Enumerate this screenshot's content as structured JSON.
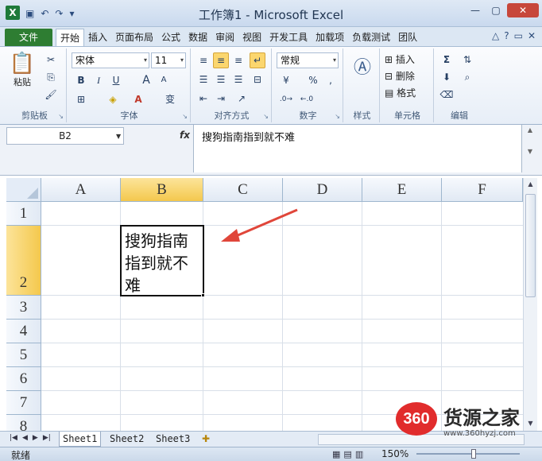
{
  "window": {
    "title": "工作簿1 - Microsoft Excel",
    "app_icon": "X",
    "quick_access": [
      "save-icon",
      "undo-icon",
      "redo-icon",
      "customize-icon"
    ],
    "controls": [
      "minimize-icon",
      "maximize-icon",
      "close-icon"
    ]
  },
  "ribbon_tabs": {
    "file": "文件",
    "items": [
      "开始",
      "插入",
      "页面布局",
      "公式",
      "数据",
      "审阅",
      "视图",
      "开发工具",
      "加载项",
      "负载测试",
      "团队"
    ],
    "active": "开始"
  },
  "ribbon": {
    "clipboard": {
      "label": "剪贴板",
      "paste": "粘贴"
    },
    "font": {
      "label": "字体",
      "name": "宋体",
      "size": "11",
      "bold": "B",
      "italic": "I",
      "underline": "U",
      "grow": "A",
      "shrink": "A",
      "wen": "变"
    },
    "alignment": {
      "label": "对齐方式"
    },
    "number": {
      "label": "数字",
      "format": "常规",
      "percent": "%"
    },
    "styles": {
      "label": "样式"
    },
    "cells": {
      "label": "单元格",
      "insert": "插入",
      "delete": "删除",
      "format": "格式"
    },
    "editing": {
      "label": "编辑",
      "sum": "Σ"
    }
  },
  "formula_bar": {
    "name_box": "B2",
    "fx": "fx",
    "content": "搜狗指南指到就不难"
  },
  "grid": {
    "columns": [
      "A",
      "B",
      "C",
      "D",
      "E",
      "F"
    ],
    "rows": [
      "1",
      "2",
      "3",
      "4",
      "5",
      "6",
      "7",
      "8"
    ],
    "selected_column": "B",
    "selected_row": "2",
    "active_cell_lines": [
      "搜狗指南",
      "指到就不",
      "难"
    ]
  },
  "sheets": {
    "tabs": [
      "Sheet1",
      "Sheet2",
      "Sheet3"
    ],
    "active": "Sheet1"
  },
  "status": {
    "text": "就绪",
    "zoom": "150%"
  },
  "watermark": {
    "logo": "360",
    "name": "货源之家",
    "url": "www.360hyzj.com"
  },
  "colors": {
    "file_tab": "#2e7d32",
    "selection_header": "#f4c84d",
    "annotation_arrow": "#e0463a"
  }
}
